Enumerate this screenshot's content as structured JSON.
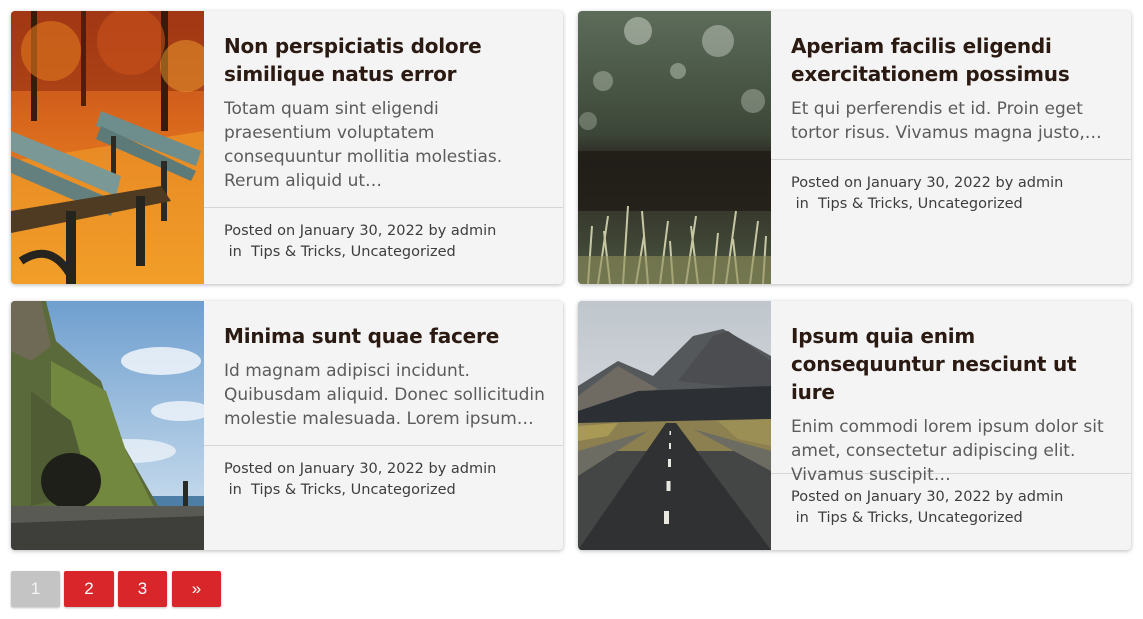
{
  "posts": [
    {
      "title": "Non perspiciatis dolore similique natus error",
      "excerpt": "Totam quam sint eligendi praesentium voluptatem consequuntur mollitia molestias. Rerum aliquid ut…",
      "posted_on": "Posted on",
      "date": "January 30, 2022",
      "by": "by",
      "author": "admin",
      "in": "in",
      "categories": [
        "Tips & Tricks",
        "Uncategorized"
      ],
      "image": "autumn-park-benches"
    },
    {
      "title": "Aperiam facilis eligendi exercitationem possimus",
      "excerpt": "Et qui perferendis et id. Proin eget tortor risus. Vivamus magna justo,…",
      "posted_on": "Posted on",
      "date": "January 30, 2022",
      "by": "by",
      "author": "admin",
      "in": "in",
      "categories": [
        "Tips & Tricks",
        "Uncategorized"
      ],
      "image": "grass-closeup"
    },
    {
      "title": "Minima sunt quae facere",
      "excerpt": "Id magnam adipisci incidunt. Quibusdam aliquid. Donec sollicitudin molestie malesuada. Lorem ipsum…",
      "posted_on": "Posted on",
      "date": "January 30, 2022",
      "by": "by",
      "author": "admin",
      "in": "in",
      "categories": [
        "Tips & Tricks",
        "Uncategorized"
      ],
      "image": "coastal-cliff"
    },
    {
      "title": "Ipsum quia enim consequuntur nesciunt ut iure",
      "excerpt": "Enim commodi lorem ipsum dolor sit amet, consectetur adipiscing elit. Vivamus suscipit…",
      "posted_on": "Posted on",
      "date": "January 30, 2022",
      "by": "by",
      "author": "admin",
      "in": "in",
      "categories": [
        "Tips & Tricks",
        "Uncategorized"
      ],
      "image": "mountain-road"
    }
  ],
  "pagination": {
    "current": "1",
    "pages": [
      "2",
      "3"
    ],
    "next": "»"
  },
  "colors": {
    "accent": "#d9262b",
    "card_bg": "#f4f4f4",
    "title": "#2a1a12",
    "current_page": "#c4c4c4"
  }
}
